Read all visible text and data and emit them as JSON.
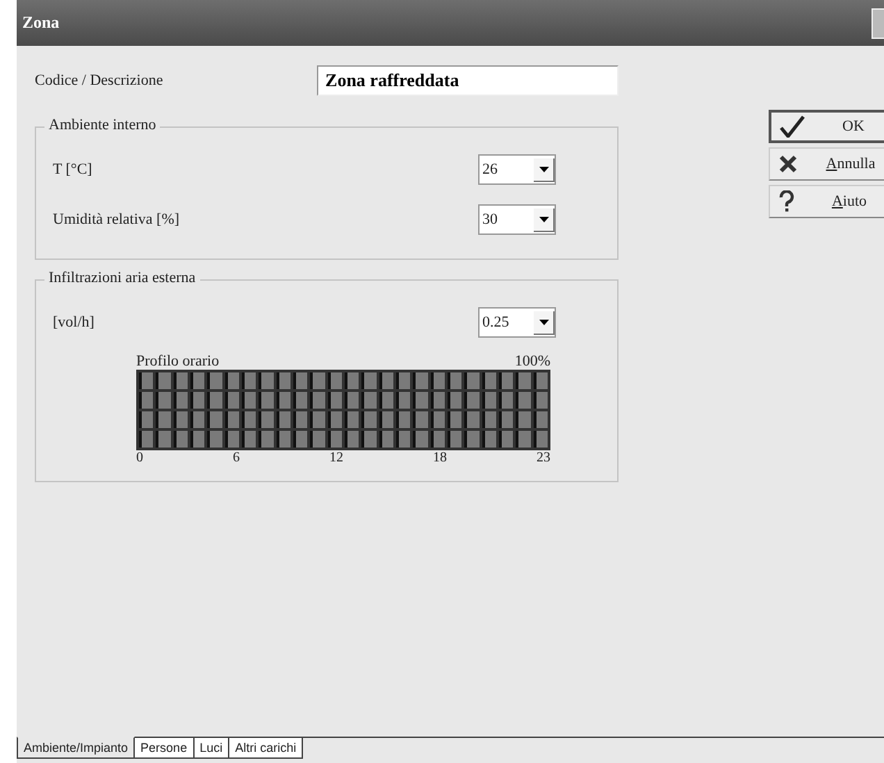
{
  "window": {
    "title": "Zona"
  },
  "code_description": {
    "label": "Codice / Descrizione",
    "value": "Zona raffreddata"
  },
  "groups": [
    {
      "title": "Ambiente interno",
      "fields": [
        {
          "label": "T [°C]",
          "value": "26"
        },
        {
          "label": "Umidità relativa [%]",
          "value": "30"
        }
      ]
    },
    {
      "title": "Infiltrazioni aria esterna",
      "fields": [
        {
          "label": "[vol/h]",
          "value": "0.25"
        }
      ],
      "profile": {
        "title": "Profilo orario",
        "max": "100%",
        "ticks": [
          "0",
          "6",
          "12",
          "18",
          "23"
        ]
      }
    }
  ],
  "buttons": [
    {
      "label": "OK",
      "kind": "ok"
    },
    {
      "label": "Annulla",
      "kind": "cancel"
    },
    {
      "label": "Aiuto",
      "kind": "help"
    }
  ],
  "tabs": [
    {
      "label": "Ambiente/Impianto",
      "selected": true
    },
    {
      "label": "Persone",
      "selected": false
    },
    {
      "label": "Luci",
      "selected": false
    },
    {
      "label": "Altri carichi",
      "selected": false
    }
  ]
}
